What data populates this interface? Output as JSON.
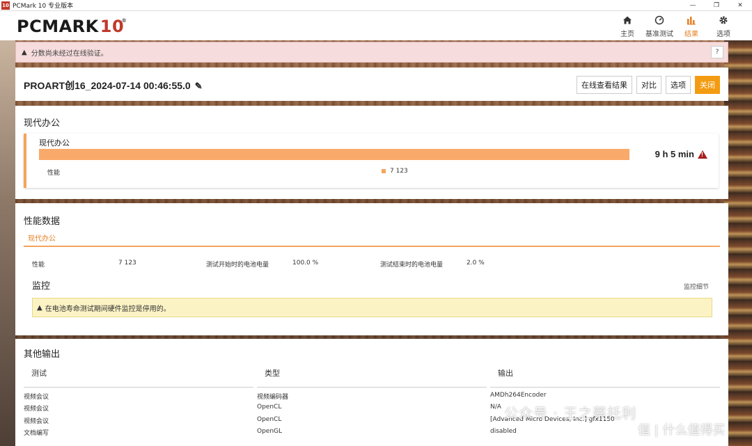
{
  "window": {
    "title": "PCMark 10 专业版本",
    "app_icon": "10",
    "controls": [
      "—",
      "❐",
      "✕"
    ]
  },
  "header": {
    "logo_main": "PCMARK",
    "logo_num": "10",
    "logo_reg": "®",
    "nav": [
      {
        "label": "主页",
        "icon": "home-icon"
      },
      {
        "label": "基准测试",
        "icon": "gauge-icon"
      },
      {
        "label": "结果",
        "icon": "bar-chart-icon",
        "active": true
      },
      {
        "label": "选项",
        "icon": "gear-icon"
      }
    ]
  },
  "banner": {
    "text": "分数尚未经过在线验证。",
    "help": "?"
  },
  "result": {
    "title": "PROART创16_2024-07-14 00:46:55.0",
    "buttons": {
      "online": "在线查看结果",
      "compare": "对比",
      "options": "选项",
      "close": "关闭"
    }
  },
  "office": {
    "section_title": "现代办公",
    "card_title": "现代办公",
    "battery_time": "9 h 5 min",
    "perf_label": "性能",
    "perf_value": "7 123",
    "accent_color": "#f5a45c"
  },
  "perf_data": {
    "section_title": "性能数据",
    "tab": "现代办公",
    "items": [
      {
        "label": "性能",
        "value": "7 123"
      },
      {
        "label": "测试开始时的电池电量",
        "value": "100.0 %"
      },
      {
        "label": "测试结束时的电池电量",
        "value": "2.0 %"
      }
    ]
  },
  "monitor": {
    "title": "监控",
    "link": "监控细节",
    "warning": "在电池寿命测试期间硬件监控是停用的。"
  },
  "other": {
    "section_title": "其他输出",
    "columns": [
      "测试",
      "类型",
      "输出"
    ],
    "rows": [
      [
        "视频会议",
        "视频编码器",
        "AMDh264Encoder"
      ],
      [
        "视频会议",
        "OpenCL",
        "N/A"
      ],
      [
        "视频会议",
        "OpenCL",
        "[Advanced Micro Devices, Inc.] gfx1150"
      ],
      [
        "文档编写",
        "OpenGL",
        "disabled"
      ]
    ]
  },
  "watermark": {
    "line1": "公众号 · 王之蔡托利",
    "line2": "值 | 什么值得买"
  }
}
